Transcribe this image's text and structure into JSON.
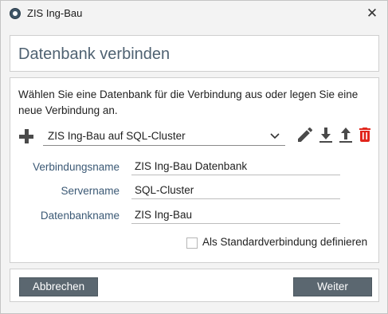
{
  "window": {
    "title": "ZIS Ing-Bau"
  },
  "header": {
    "title": "Datenbank verbinden"
  },
  "main": {
    "instruction": "Wählen Sie eine Datenbank für die Verbindung aus oder legen Sie eine neue Verbindung an.",
    "connection_select": {
      "selected": "ZIS Ing-Bau auf SQL-Cluster"
    },
    "fields": [
      {
        "label": "Verbindungsname",
        "value": "ZIS Ing-Bau Datenbank"
      },
      {
        "label": "Servername",
        "value": "SQL-Cluster"
      },
      {
        "label": "Datenbankname",
        "value": "ZIS Ing-Bau"
      }
    ],
    "default_checkbox": {
      "label": "Als Standardverbindung definieren",
      "checked": false
    }
  },
  "footer": {
    "cancel_label": "Abbrechen",
    "next_label": "Weiter"
  },
  "colors": {
    "button_bg": "#5b6770",
    "delete_red": "#e1261c",
    "header_text": "#4f6272",
    "label_text": "#3b5975"
  }
}
